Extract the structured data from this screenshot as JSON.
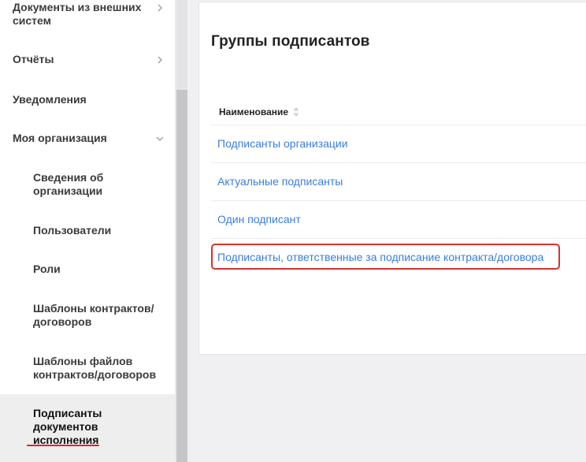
{
  "sidebar": {
    "items": [
      {
        "label": "Документы из внешних систем",
        "chevron": "right"
      },
      {
        "label": "Отчёты",
        "chevron": "right"
      },
      {
        "label": "Уведомления",
        "chevron": ""
      },
      {
        "label": "Моя организация",
        "chevron": "down"
      }
    ],
    "subitems": [
      {
        "label": "Сведения об организации"
      },
      {
        "label": "Пользователи"
      },
      {
        "label": "Роли"
      },
      {
        "label": "Шаблоны контрактов/договоров"
      },
      {
        "label": "Шаблоны файлов контрактов/договоров"
      },
      {
        "label": "Подписанты документов исполнения",
        "active": true
      }
    ]
  },
  "main": {
    "title": "Группы подписантов",
    "table": {
      "column_header": "Наименование",
      "rows": [
        "Подписанты организации",
        "Актуальные подписанты",
        "Один подписант",
        "Подписанты, ответственные за подписание контракта/договора"
      ]
    }
  },
  "colors": {
    "link": "#3b7ddb",
    "highlight": "#d8322f",
    "active_bg": "#eeeeee"
  },
  "icons": [
    "chevron-right-icon",
    "chevron-down-icon",
    "sort-icon"
  ]
}
